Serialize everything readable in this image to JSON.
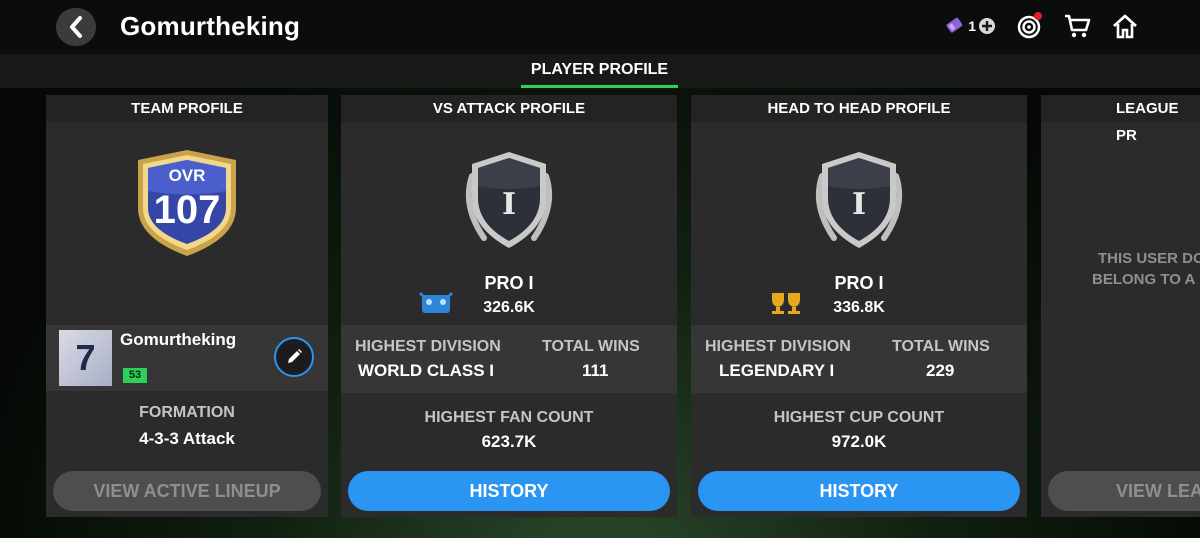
{
  "header": {
    "title": "Gomurtheking",
    "token_count": "1"
  },
  "tabs": {
    "active": "PLAYER PROFILE"
  },
  "team_profile": {
    "header": "TEAM PROFILE",
    "ovr_label": "OVR",
    "ovr_value": "107",
    "jersey_number": "7",
    "player_name": "Gomurtheking",
    "level_badge": "53",
    "formation_label": "FORMATION",
    "formation_value": "4-3-3 Attack",
    "lineup_button": "VIEW ACTIVE LINEUP"
  },
  "vs_attack": {
    "header": "VS ATTACK PROFILE",
    "rank_numeral": "I",
    "rank": "PRO I",
    "points": "326.6K",
    "highest_division_label": "HIGHEST DIVISION",
    "highest_division_value": "WORLD CLASS I",
    "total_wins_label": "TOTAL WINS",
    "total_wins_value": "111",
    "stat_label": "HIGHEST FAN COUNT",
    "stat_value": "623.7K",
    "history_button": "HISTORY"
  },
  "head_to_head": {
    "header": "HEAD TO HEAD PROFILE",
    "rank_numeral": "I",
    "rank": "PRO I",
    "points": "336.8K",
    "highest_division_label": "HIGHEST DIVISION",
    "highest_division_value": "LEGENDARY I",
    "total_wins_label": "TOTAL WINS",
    "total_wins_value": "229",
    "stat_label": "HIGHEST CUP COUNT",
    "stat_value": "972.0K",
    "history_button": "HISTORY"
  },
  "league_profile": {
    "header": "LEAGUE PR",
    "message_line1": "THIS USER DO",
    "message_line2": "BELONG TO A",
    "button": "VIEW LEA"
  },
  "colors": {
    "accent_green": "#2fd05a",
    "button_blue": "#2a95f2",
    "badge_green": "#2fd05a",
    "notification_red": "#e0202a"
  }
}
